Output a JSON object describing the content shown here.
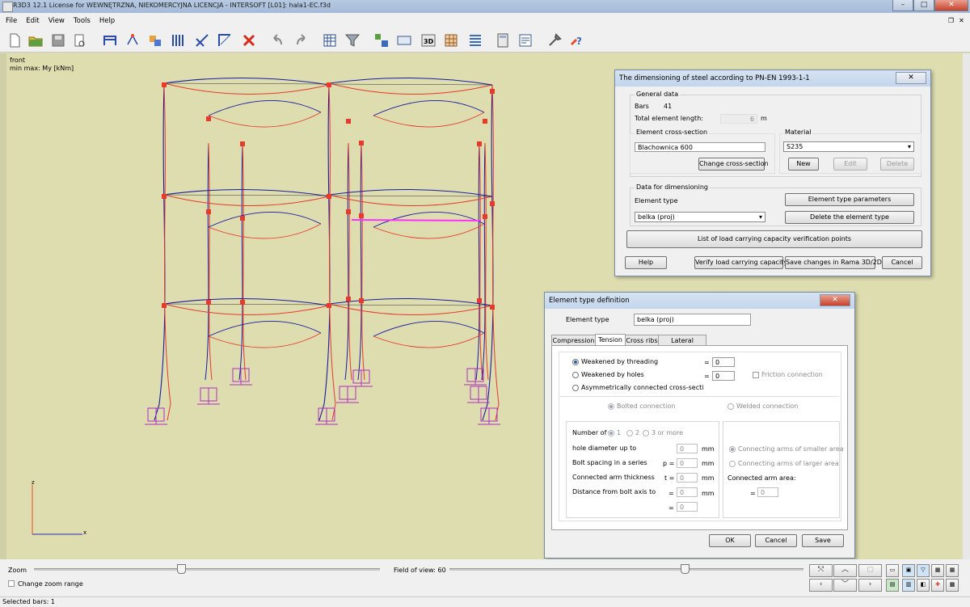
{
  "titlebar": {
    "title": "R3D3 12.1 License for WEWNĘTRZNA, NIEKOMERCYJNA LICENCJA - INTERSOFT [L01]: hala1-EC.f3d",
    "min": "–",
    "max": "□",
    "close": "✕"
  },
  "menu": {
    "items": [
      "File",
      "Edit",
      "View",
      "Tools",
      "Help"
    ],
    "restore": [
      "❐",
      "✕"
    ]
  },
  "view": {
    "label": "front\nmin max: My [kNm]",
    "axis_z": "z",
    "axis_x": "x"
  },
  "colors": {
    "frame_red": "#e8392b",
    "frame_blue": "#1a1aa0",
    "support": "#b030c0",
    "highlight": "#ff30ff",
    "background": "#ddddb0"
  },
  "main_dialog": {
    "title": "The dimensioning of steel according to PN-EN 1993-1-1",
    "general_data": "General data",
    "bars_label": "Bars",
    "bars_value": "41",
    "length_label": "Total element length:",
    "length_value": "6",
    "length_unit": "m",
    "cross_section_group": "Element cross-section",
    "cross_section_value": "Blachownica 600",
    "change_cross_section": "Change cross-section",
    "material_group": "Material",
    "material_value": "S235",
    "new_btn": "New",
    "edit_btn": "Edit",
    "delete_btn": "Delete",
    "data_group": "Data for dimensioning",
    "element_type_label": "Element type",
    "element_type_value": "belka (proj)",
    "element_params_btn": "Element type parameters",
    "delete_type_btn": "Delete the element type",
    "list_btn": "List of load carrying capacity verification points",
    "help_btn": "Help",
    "verify_btn": "Verify load carrying capacity",
    "save_btn": "Save changes in Rama 3D/2D",
    "cancel_btn": "Cancel"
  },
  "etype_dialog": {
    "title": "Element type definition",
    "element_type_label": "Element type",
    "element_type_value": "belka (proj)",
    "tabs": [
      "Compression",
      "Tension",
      "Cross ribs",
      "Lateral buckling"
    ],
    "weak_thread": "Weakened by threading",
    "weak_holes": "Weakened by holes",
    "asym": "Asymmetrically connected cross-secti",
    "eq": "=",
    "thread_value": "0",
    "holes_value": "0",
    "friction": "Friction connection",
    "bolted": "Bolted connection",
    "welded": "Welded connection",
    "number_of": "Number of",
    "n1": "1",
    "n2": "2",
    "n3": "3 or more",
    "hole_dia": "hole diameter up to",
    "spacing": "Bolt spacing in a series",
    "thickness": "Connected arm thickness",
    "distance": "Distance from bolt axis to",
    "p_eq": "p =",
    "t_eq": "t =",
    "zero": "0",
    "mm": "mm",
    "smaller": "Connecting arms of smaller area",
    "larger": "Connecting arms of larger area",
    "arm_area": "Connected arm area:",
    "ok": "OK",
    "cancel": "Cancel",
    "save": "Save"
  },
  "bottom": {
    "zoom": "Zoom",
    "change_zoom": "Change zoom range",
    "fov": "Field of view: 60"
  },
  "status": {
    "text": "Selected bars: 1"
  }
}
